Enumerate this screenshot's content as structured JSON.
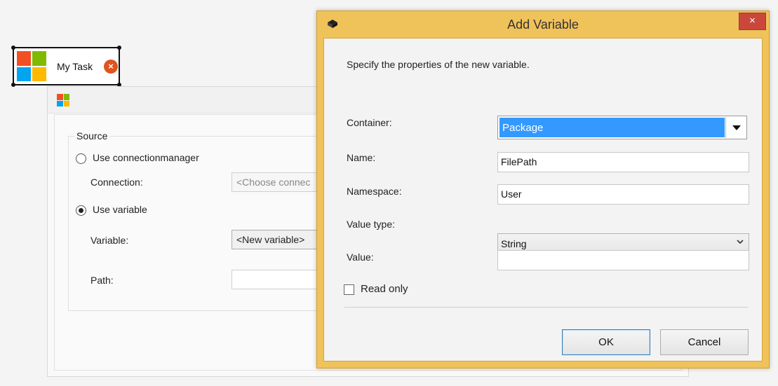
{
  "task": {
    "name": "My Task",
    "error_icon": "error-x-icon",
    "error_glyph": "×"
  },
  "editor": {
    "source_legend": "Source",
    "use_connection_label": "Use connectionmanager",
    "connection_label": "Connection:",
    "connection_placeholder": "<Choose connec",
    "use_variable_label": "Use variable",
    "variable_label": "Variable:",
    "variable_value": "<New variable>",
    "path_label": "Path:",
    "path_value": "",
    "selected_source": "Use variable"
  },
  "dialog": {
    "title": "Add Variable",
    "close_glyph": "×",
    "description": "Specify the properties of the new variable.",
    "container_label": "Container:",
    "container_value": "Package",
    "name_label": "Name:",
    "name_value": "FilePath",
    "namespace_label": "Namespace:",
    "namespace_value": "User",
    "value_type_label": "Value type:",
    "value_type_value": "String",
    "value_label": "Value:",
    "value_value": "",
    "read_only_label": "Read only",
    "read_only_checked": false,
    "ok_label": "OK",
    "cancel_label": "Cancel"
  },
  "colors": {
    "dialog_frame": "#f0c25a",
    "close_button": "#c9483b",
    "selection_highlight": "#3399ff",
    "logo_red": "#f25022",
    "logo_green": "#7fba00",
    "logo_blue": "#00a4ef",
    "logo_yellow": "#ffb900"
  }
}
